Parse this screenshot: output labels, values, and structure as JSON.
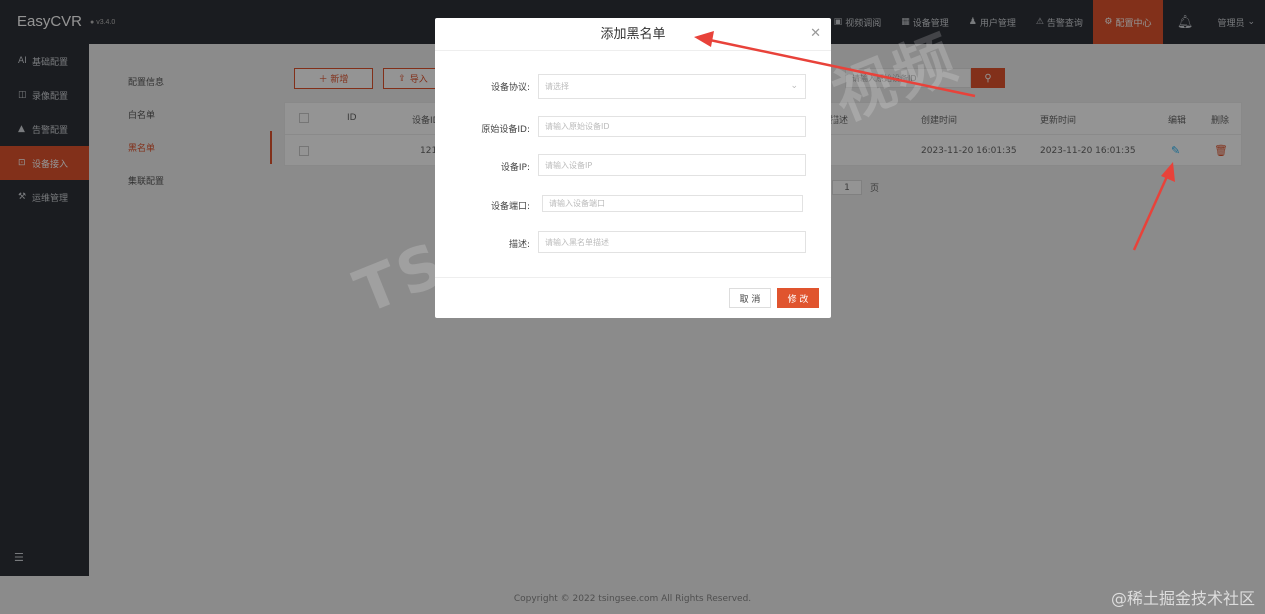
{
  "app": {
    "name": "EasyCVR",
    "version": "v3.4.0"
  },
  "topnav": {
    "items": [
      {
        "icon": "monitor-icon",
        "label": "视频调阅"
      },
      {
        "icon": "device-icon",
        "label": "设备管理"
      },
      {
        "icon": "user-icon",
        "label": "用户管理"
      },
      {
        "icon": "alarm-icon",
        "label": "告警查询"
      },
      {
        "icon": "gear-icon",
        "label": "配置中心",
        "active": true
      }
    ],
    "user": "管理员"
  },
  "sidebar": {
    "items": [
      {
        "icon": "ai-icon",
        "label": "基础配置"
      },
      {
        "icon": "record-icon",
        "label": "录像配置"
      },
      {
        "icon": "alert-icon",
        "label": "告警配置"
      },
      {
        "icon": "device-access-icon",
        "label": "设备接入",
        "active": true
      },
      {
        "icon": "tools-icon",
        "label": "运维管理"
      }
    ]
  },
  "submenu": {
    "items": [
      {
        "label": "配置信息"
      },
      {
        "label": "白名单"
      },
      {
        "label": "黑名单",
        "active": true
      },
      {
        "label": "集联配置"
      }
    ]
  },
  "toolbar": {
    "add_label": "＋ 新增",
    "import_label": "导入",
    "search_placeholder": "请输入原始设备ID"
  },
  "table": {
    "headers": [
      "ID",
      "设备ID",
      "描述",
      "创建时间",
      "更新时间",
      "编辑",
      "删除"
    ],
    "rows": [
      {
        "device_id": "121",
        "created": "2023-11-20 16:01:35",
        "updated": "2023-11-20 16:01:35"
      }
    ]
  },
  "pager": {
    "page": "1",
    "suffix": "页"
  },
  "footer": {
    "copyright": "Copyright © 2022 tsingsee.com All Rights Reserved.",
    "mark": "@稀土掘金技术社区"
  },
  "watermark": "TSINGSEE 青犀视频",
  "modal": {
    "title": "添加黑名单",
    "fields": [
      {
        "label": "设备协议:",
        "placeholder": "请选择",
        "type": "select"
      },
      {
        "label": "原始设备ID:",
        "placeholder": "请输入原始设备ID"
      },
      {
        "label": "设备IP:",
        "placeholder": "请输入设备IP"
      },
      {
        "label": "设备端口:",
        "placeholder": "请输入设备端口"
      },
      {
        "label": "描述:",
        "placeholder": "请输入黑名单描述"
      }
    ],
    "cancel_label": "取 消",
    "submit_label": "修 改"
  },
  "colors": {
    "accent": "#e0542e",
    "dark": "#2e3137",
    "arrow": "#e8423a"
  }
}
